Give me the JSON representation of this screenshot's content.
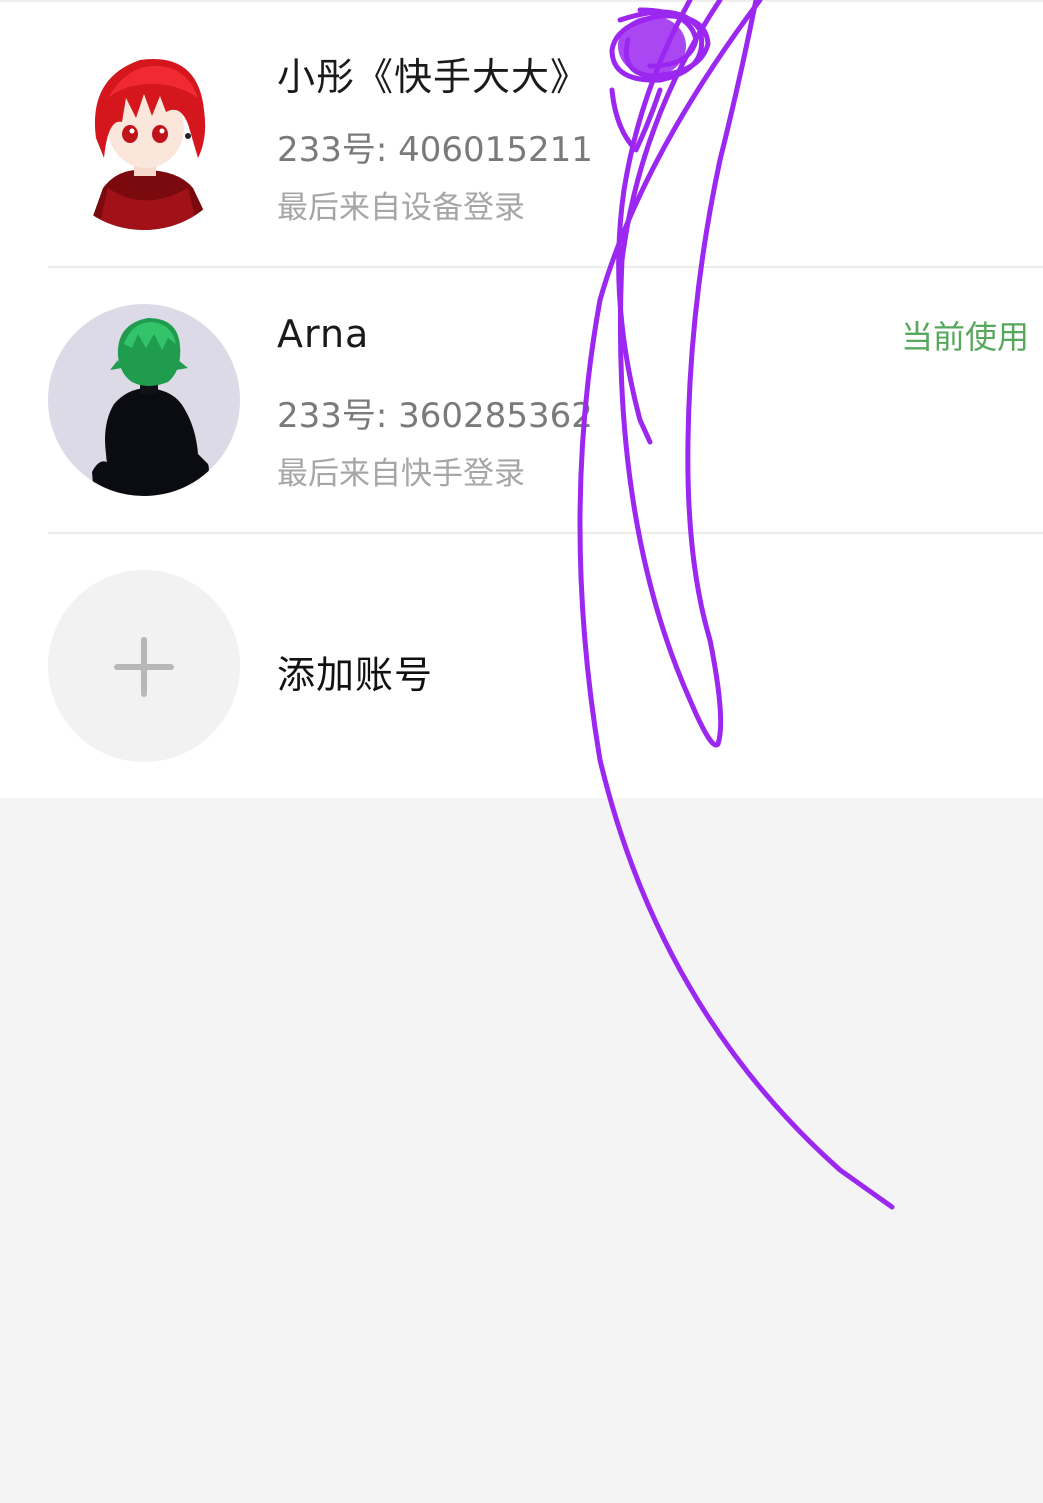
{
  "accounts": [
    {
      "name": "小彤《快手大大》",
      "uid": "233号: 406015211",
      "last_login": "最后来自设备登录",
      "avatar": "red-hair-character-avatar",
      "current_label": ""
    },
    {
      "name": "Arna",
      "uid": "233号: 360285362",
      "last_login": "最后来自快手登录",
      "avatar": "green-hair-character-avatar",
      "current_label": "当前使用"
    }
  ],
  "add_account": {
    "label": "添加账号",
    "icon": "plus-icon"
  },
  "colors": {
    "current_badge": "#57a85d",
    "scribble": "#9b27f0",
    "background": "#f4f4f4"
  }
}
